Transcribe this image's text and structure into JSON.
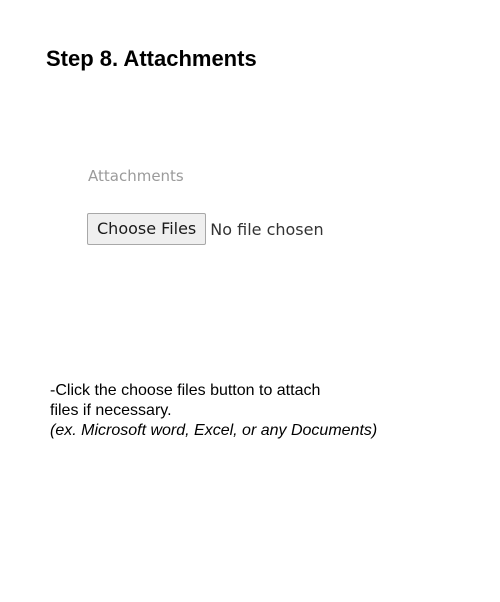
{
  "heading": "Step 8. Attachments",
  "form": {
    "label": "Attachments",
    "button_label": "Choose Files",
    "status": "No file chosen"
  },
  "instructions": {
    "line1": "-Click the choose files button to attach",
    "line2": "files if necessary.",
    "line3": "(ex. Microsoft word, Excel, or any Documents)"
  }
}
